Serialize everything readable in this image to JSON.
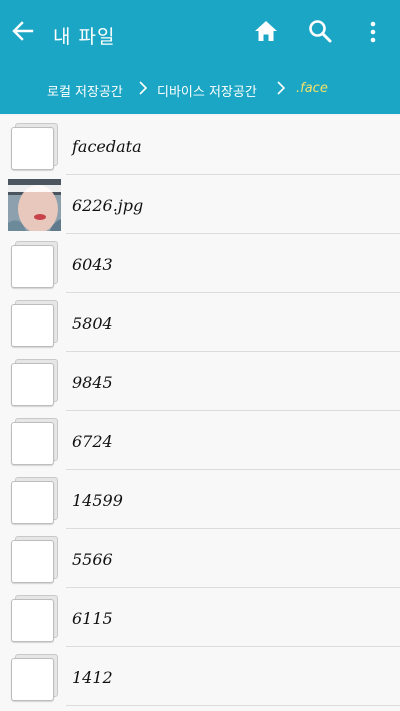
{
  "header": {
    "title": "내 파일",
    "icons": {
      "back": "arrow-back-icon",
      "home": "home-icon",
      "search": "search-icon",
      "more": "more-vert-icon"
    },
    "colors": {
      "bar": "#1aa6c4",
      "current_crumb": "#f4e26b"
    }
  },
  "breadcrumb": [
    {
      "label": "로컬 저장공간"
    },
    {
      "label": "디바이스 저장공간"
    },
    {
      "label": ".face"
    }
  ],
  "files": [
    {
      "name": "facedata",
      "type": "folder"
    },
    {
      "name": "6226.jpg",
      "type": "image"
    },
    {
      "name": "6043",
      "type": "folder"
    },
    {
      "name": "5804",
      "type": "folder"
    },
    {
      "name": "9845",
      "type": "folder"
    },
    {
      "name": "6724",
      "type": "folder"
    },
    {
      "name": "14599",
      "type": "folder"
    },
    {
      "name": "5566",
      "type": "folder"
    },
    {
      "name": "6115",
      "type": "folder"
    },
    {
      "name": "1412",
      "type": "folder"
    }
  ]
}
